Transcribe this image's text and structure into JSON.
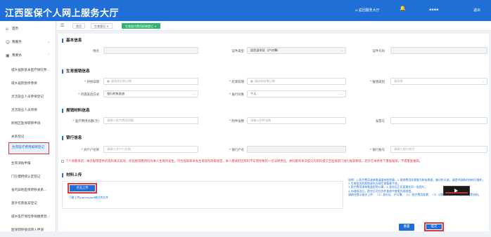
{
  "header": {
    "logo": "江西医保个人网上服务大厅",
    "service_hall": "返回服务大厅",
    "user": "▪▪▪▪",
    "logout": "退出"
  },
  "sidebar": {
    "home": "首页",
    "my_service": "我服务",
    "my_handle": "我要办",
    "items": [
      "城乡居民基本医疗保险参...",
      "城乡居民暂停参保",
      "灵活就业人员参保登记",
      "灵活就业人员停保",
      "跨地区医保转移申请",
      "关系登记",
      "生育医疗费用报销登记",
      "生育津贴申报",
      "门诊慢特病认定登记",
      "省内异地医保转移关系...",
      "意外伤害备案登记",
      "城乡医疗保险参保缴费登...",
      "医保转移接续转入申请"
    ]
  },
  "tabs": {
    "home": "首页",
    "birth_reg": "生育登记 ×",
    "birth_claim": "生育医疗费用报销登记 ×"
  },
  "basic": {
    "title": "基本信息",
    "name_label": "姓名",
    "idtype_label": "证件类型",
    "idtype_value": "居民身份证（户口簿）",
    "idno_label": "证件号码"
  },
  "birth": {
    "title": "生育报销信息",
    "start_label": "开始日期",
    "start_ph": "请选择开始日期",
    "end_label": "结束日期",
    "end_ph": "请选择结束日期",
    "type_label": "报销类别",
    "type_ph": "请选择",
    "pay_label": "待遇发放方式",
    "pay_value": "银行转账发放",
    "target_label": "报付对象",
    "target_value": "个人"
  },
  "material": {
    "title": "报销材料信息",
    "inst_label": "医疗费用总额(元)",
    "inst_ph": "请输入医疗费用总额",
    "attach_label": "附件张数",
    "attach_ph": "请输入附件张数",
    "invoice_label": "发票号"
  },
  "bank": {
    "title": "银行信息",
    "holder_label": "开户户名称",
    "holder_ph": "请输入开户行名称",
    "account_name_label": "银行户名",
    "account_no_label": "银行账号",
    "account_no_ph": "请输入银行账号"
  },
  "notice": "个人郑重承诺：本次报销提供的资料真实有效，所有报销费用均为本人生育所发生，符合国家和本省生育保险政策规定，本人愿承担因资料不实而导致的一切法律责任，并同意将本次提交的资料提交至医保部门进行报销审核。若存在本条件下重复报销，不得重复报销。",
  "upload": {
    "title": "材料上传",
    "button": "点击上传",
    "hint": "只能上传jpg/png/pdf格式的文件"
  },
  "instructions": [
    "说明：1.医疗费用清单需请盖有医院章，2.报销费用发票需为原始票据，复印件无效，请提供清晰的材料扫描件。",
    "2.生育相关的报销请先办理生育备案手续。",
    "3.医疗费用清单需盖医院公章，4.身份证正反面需在同一张图片。",
    "4.办理成功后，提交后可在办件查询中查看办理进度。",
    "请按住提示依次上传：（1）身份证、户口簿；（2）医疗费用发票；（3）诊断证明；（4）出院小结等材料。"
  ],
  "buttons": {
    "reset": "重置",
    "submit": "提交"
  },
  "colors": {
    "primary": "#1f6fd6",
    "highlight": "#e0373f",
    "tab_active": "#2fb36e"
  }
}
